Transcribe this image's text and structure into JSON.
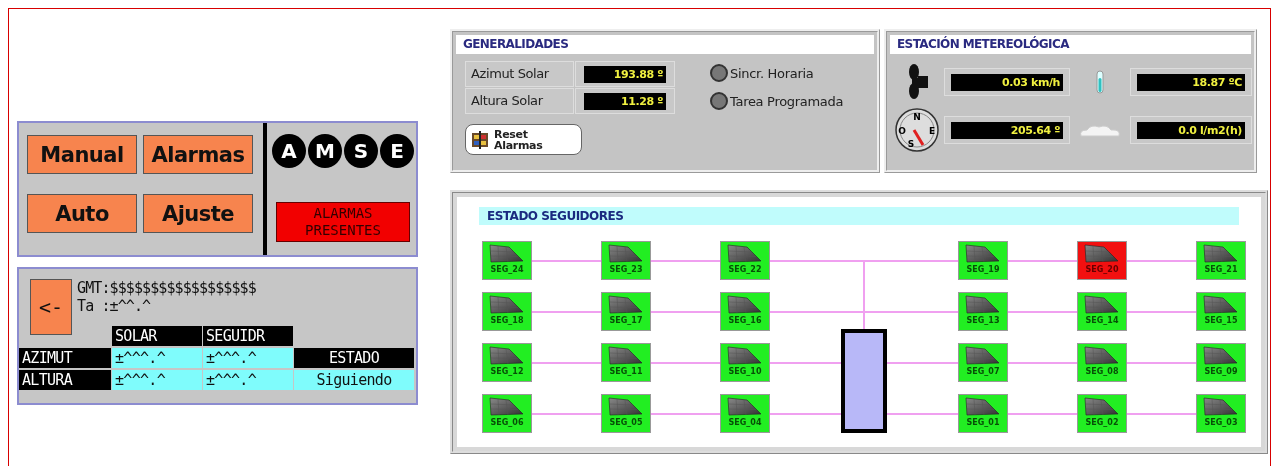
{
  "mode_panel": {
    "buttons": [
      {
        "label": "Manual"
      },
      {
        "label": "Alarmas"
      },
      {
        "label": "Auto"
      },
      {
        "label": "Ajuste"
      }
    ],
    "mode_letters": [
      {
        "label": "A"
      },
      {
        "label": "M"
      },
      {
        "label": "S"
      },
      {
        "label": "E"
      }
    ],
    "alarm_banner": {
      "text": "ALARMAS PRESENTES",
      "active": true
    }
  },
  "position_panel": {
    "back_button": "<-",
    "gmt": "GMT:$$$$$$$$$$$$$$$$$$",
    "ta": "Ta :±^^.^",
    "table": {
      "columns": [
        "SOLAR",
        "SEGUIDR"
      ],
      "rows": [
        {
          "label": "AZIMUT",
          "solar": "±^^^.^",
          "tracker": "±^^^.^"
        },
        {
          "label": "ALTURA",
          "solar": "±^^^.^",
          "tracker": "±^^^.^"
        }
      ],
      "status_label": "ESTADO",
      "status_value": "Siguiendo"
    }
  },
  "generalidades": {
    "title": "GENERALIDADES",
    "readings": [
      {
        "label": "Azimut Solar",
        "value": "193.88 º"
      },
      {
        "label": "Altura Solar",
        "value": "11.28 º"
      }
    ],
    "indicators": [
      {
        "label": "Sincr. Horaria",
        "on": false
      },
      {
        "label": "Tarea Programada",
        "on": false
      }
    ],
    "reset_button": "Reset Alarmas"
  },
  "estacion": {
    "title": "ESTACIÓN METEREOLÓGICA",
    "compass_letters": {
      "n": "N",
      "o": "O",
      "e": "E",
      "s": "S"
    },
    "readings": [
      {
        "kind": "wind",
        "value": "0.03 km/h"
      },
      {
        "kind": "temperature",
        "value": "18.87 ºC"
      },
      {
        "kind": "direction",
        "value": "205.64 º"
      },
      {
        "kind": "rain",
        "value": "0.0 l/m2(h)"
      }
    ]
  },
  "estado": {
    "title": "ESTADO SEGUIDORES",
    "rows": [
      [
        {
          "label": "SEG_24",
          "alarm": false
        },
        {
          "label": "SEG_23",
          "alarm": false
        },
        {
          "label": "SEG_22",
          "alarm": false
        },
        {
          "label": "SEG_19",
          "alarm": false
        },
        {
          "label": "SEG_20",
          "alarm": true
        },
        {
          "label": "SEG_21",
          "alarm": false
        }
      ],
      [
        {
          "label": "SEG_18",
          "alarm": false
        },
        {
          "label": "SEG_17",
          "alarm": false
        },
        {
          "label": "SEG_16",
          "alarm": false
        },
        {
          "label": "SEG_13",
          "alarm": false
        },
        {
          "label": "SEG_14",
          "alarm": false
        },
        {
          "label": "SEG_15",
          "alarm": false
        }
      ],
      [
        {
          "label": "SEG_12",
          "alarm": false
        },
        {
          "label": "SEG_11",
          "alarm": false
        },
        {
          "label": "SEG_10",
          "alarm": false
        },
        {
          "label": "SEG_07",
          "alarm": false
        },
        {
          "label": "SEG_08",
          "alarm": false
        },
        {
          "label": "SEG_09",
          "alarm": false
        }
      ],
      [
        {
          "label": "SEG_06",
          "alarm": false
        },
        {
          "label": "SEG_05",
          "alarm": false
        },
        {
          "label": "SEG_04",
          "alarm": false
        },
        {
          "label": "SEG_01",
          "alarm": false
        },
        {
          "label": "SEG_02",
          "alarm": false
        },
        {
          "label": "SEG_03",
          "alarm": false
        }
      ]
    ]
  }
}
